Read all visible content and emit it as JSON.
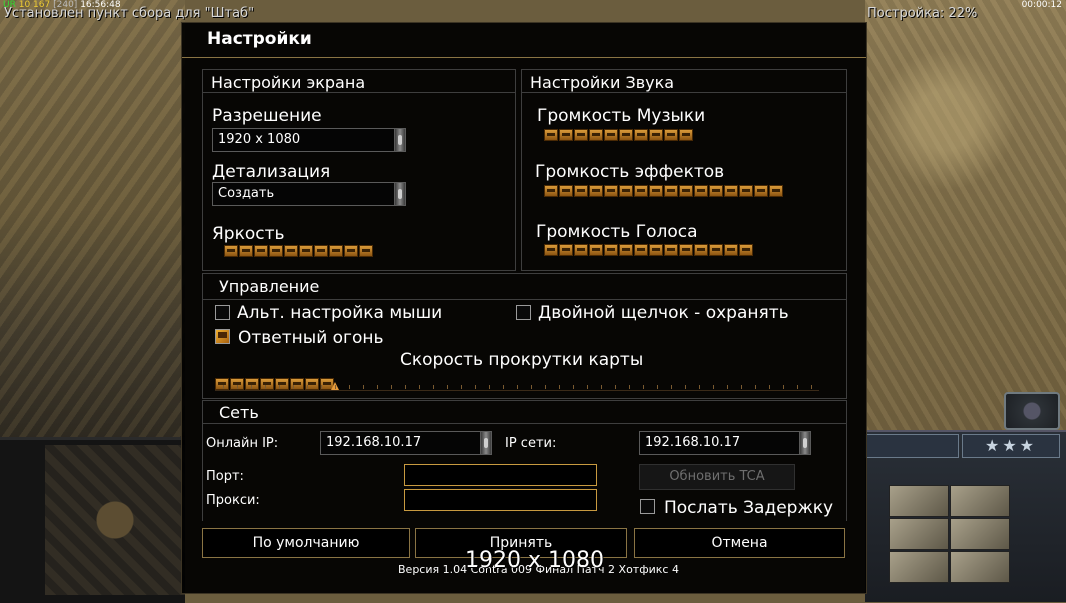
{
  "hud": {
    "stat_a": "UR",
    "stat_b": "10",
    "stat_c": "167",
    "stat_d": "[240]",
    "clock": "16:56:48",
    "message": "Установлен пункт сбора для \"Штаб\"",
    "build_progress": "Постройка: 22%",
    "game_time": "00:00:12",
    "rank_stars": "★★★"
  },
  "dialog": {
    "title": "Настройки",
    "screen": {
      "title": "Настройки экрана",
      "resolution_label": "Разрешение",
      "resolution_value": "1920 x 1080",
      "detail_label": "Детализация",
      "detail_value": "Создать",
      "brightness_label": "Яркость",
      "brightness_level": 0.6
    },
    "sound": {
      "title": "Настройки Звука",
      "music_label": "Громкость Музыки",
      "music_level": 0.6,
      "effects_label": "Громкость эффектов",
      "effects_level": 1.0,
      "voice_label": "Громкость Голоса",
      "voice_level": 0.9
    },
    "controls": {
      "title": "Управление",
      "alt_mouse_label": "Альт. настройка мыши",
      "alt_mouse_checked": false,
      "double_click_label": "Двойной щелчок - охранять",
      "double_click_checked": false,
      "return_fire_label": "Ответный огонь",
      "return_fire_checked": true,
      "scroll_speed_label": "Скорость прокрутки карты",
      "scroll_speed_level": 0.18
    },
    "network": {
      "title": "Сеть",
      "online_ip_label": "Онлайн IP:",
      "online_ip_value": "192.168.10.17",
      "lan_ip_label": "IP сети:",
      "lan_ip_value": "192.168.10.17",
      "port_label": "Порт:",
      "port_value": "",
      "proxy_label": "Прокси:",
      "proxy_value": "",
      "update_tca_label": "Обновить TCA",
      "send_delay_label": "Послать Задержку",
      "send_delay_checked": false
    },
    "buttons": {
      "default_label": "По умолчанию",
      "accept_label": "Принять",
      "cancel_label": "Отмена"
    },
    "version_text": "Версия 1.04 Contra 009 Финал Патч 2 Хотфикс 4",
    "resolution_overlay": "1920 x 1080"
  },
  "colors": {
    "accent": "#8a7444",
    "slider": "#d99a3a",
    "input_border": "#c89a40"
  }
}
